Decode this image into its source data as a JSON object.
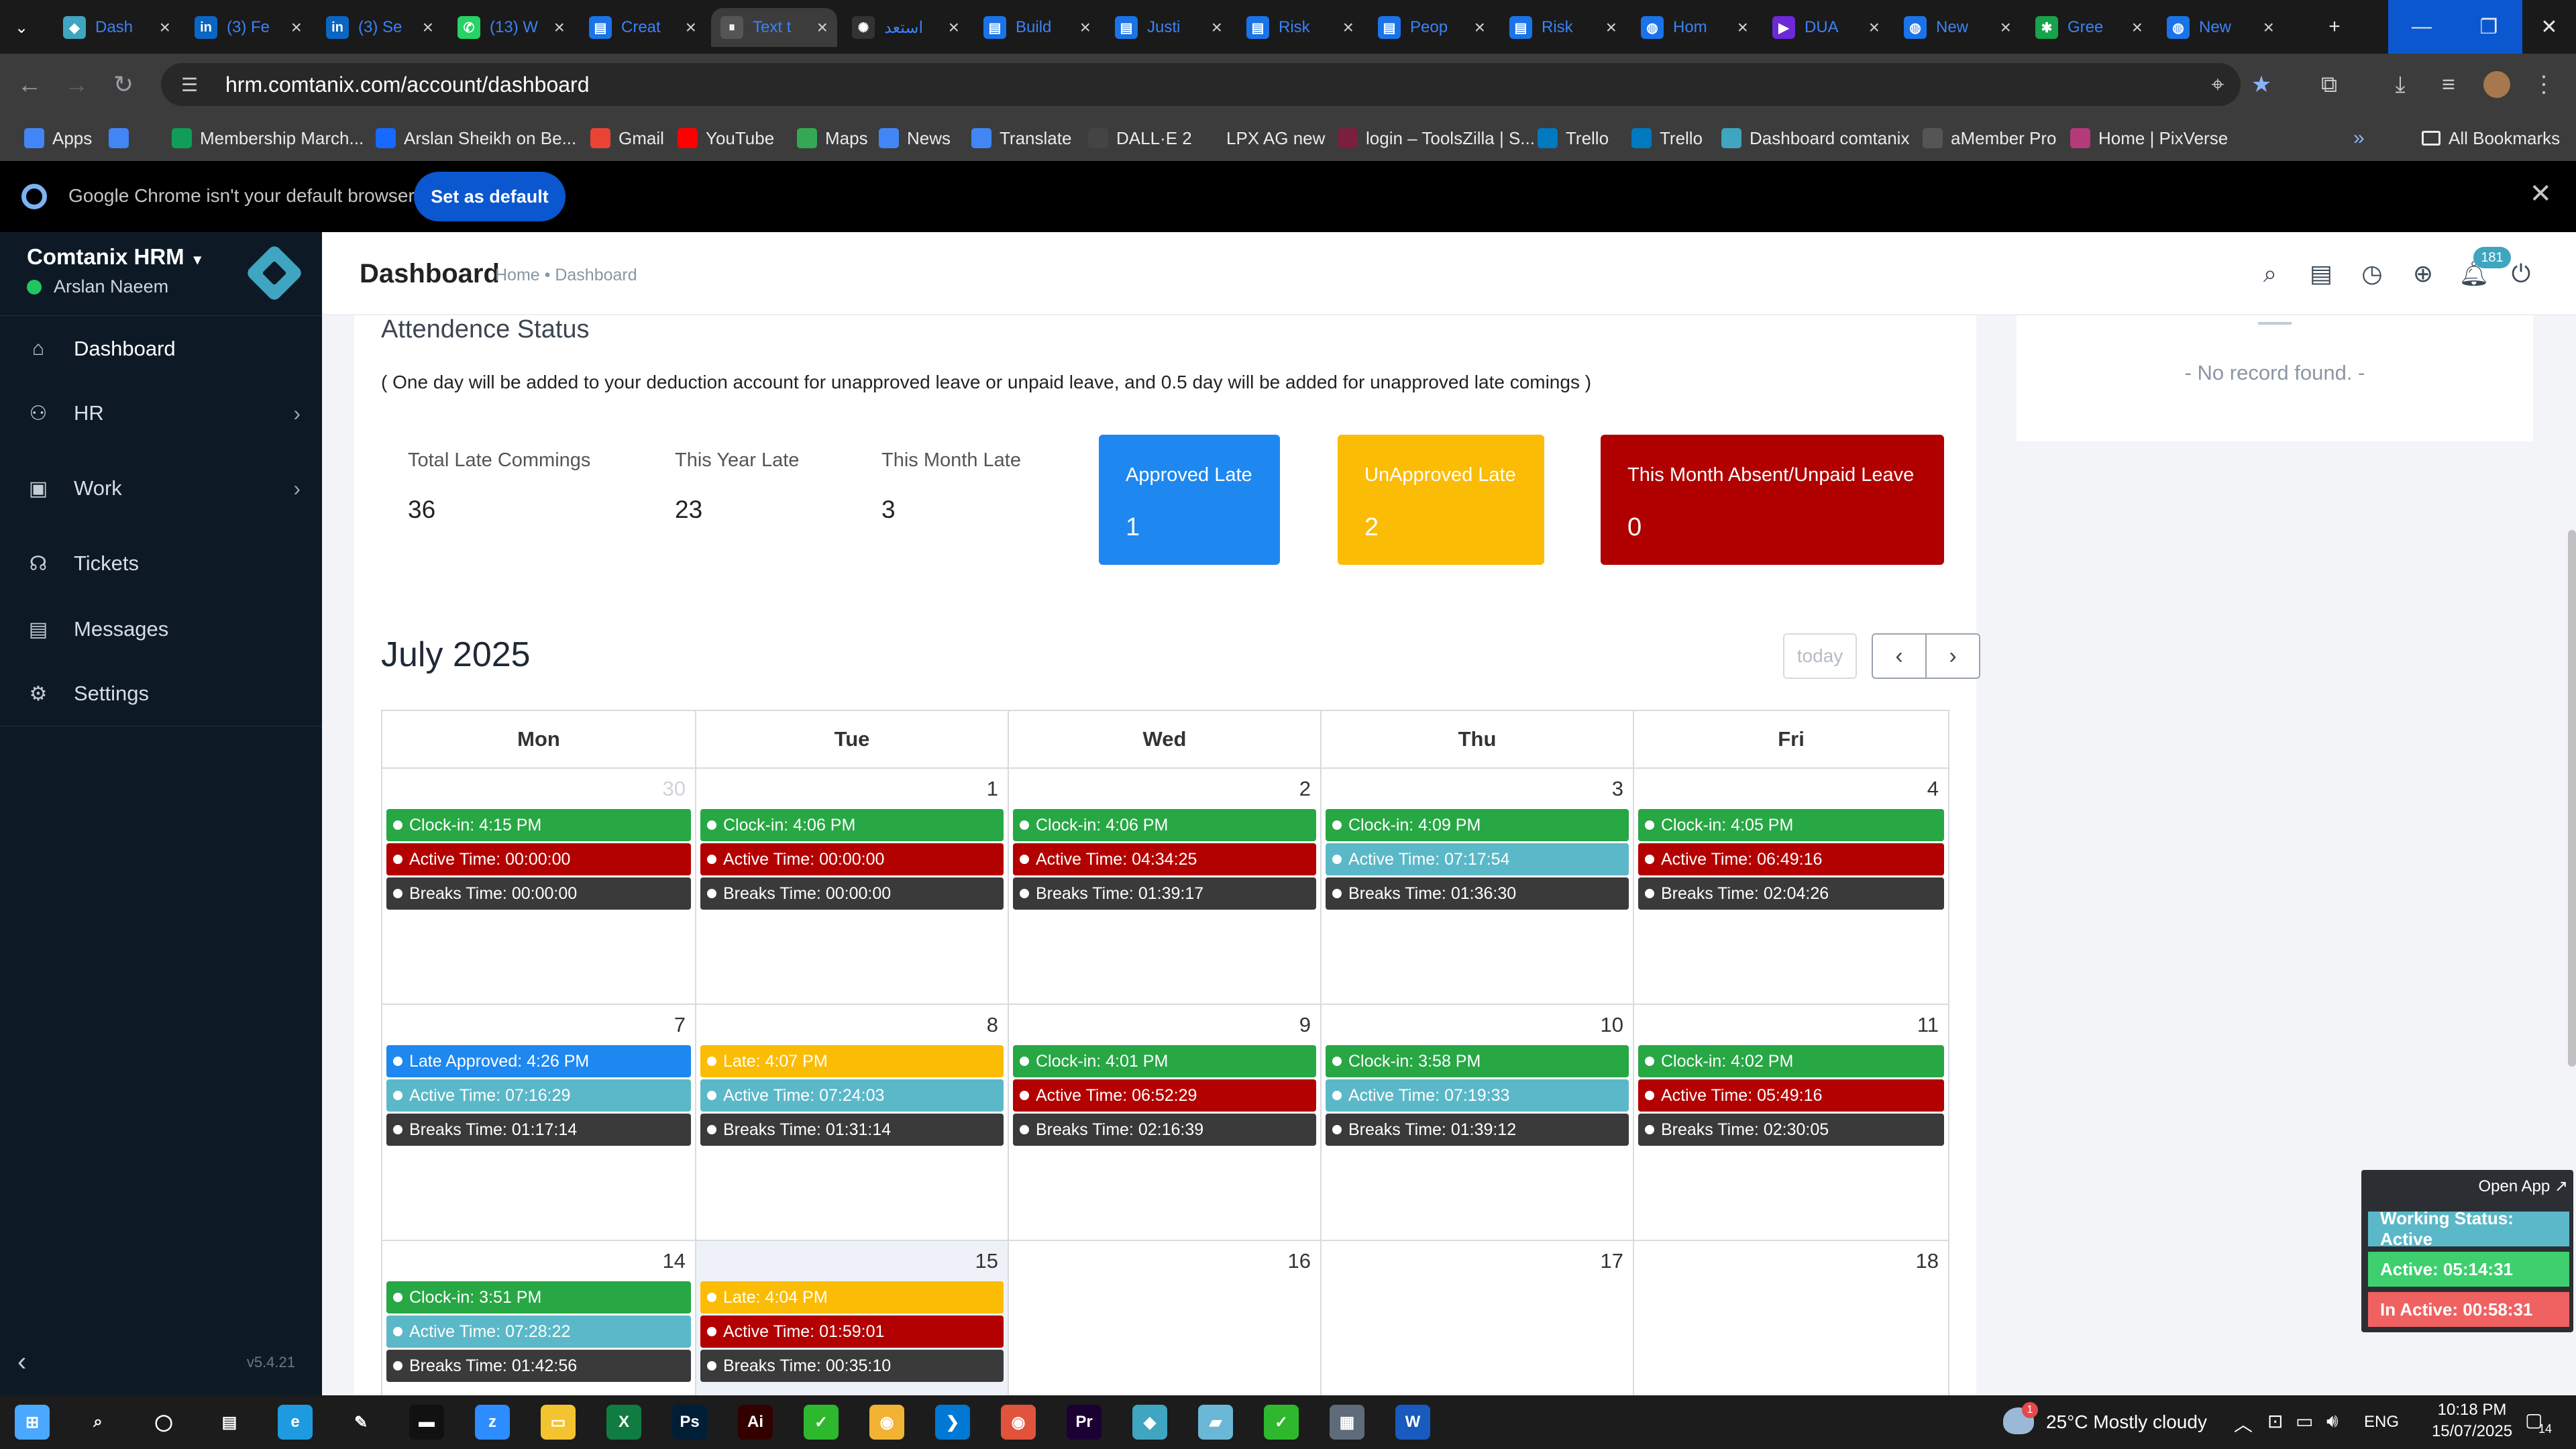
{
  "browser": {
    "tabs": [
      {
        "label": "Dash",
        "icon": "comtanix-icon",
        "color": "#3fa5c0"
      },
      {
        "label": "(3) Fe",
        "icon": "linkedin-icon",
        "color": "#0a66c2"
      },
      {
        "label": "(3) Se",
        "icon": "linkedin-icon",
        "color": "#0a66c2"
      },
      {
        "label": "(13) W",
        "icon": "whatsapp-icon",
        "color": "#25d366"
      },
      {
        "label": "Creat",
        "icon": "forms-icon",
        "color": "#1a73e8"
      },
      {
        "label": "Text t",
        "icon": "pause-icon",
        "color": "#555555"
      },
      {
        "label": "استعد",
        "icon": "openai-icon",
        "color": "#333333"
      },
      {
        "label": "Build",
        "icon": "forms-icon",
        "color": "#1a73e8"
      },
      {
        "label": "Justi",
        "icon": "forms-icon",
        "color": "#1a73e8"
      },
      {
        "label": "Risk",
        "icon": "forms-icon",
        "color": "#1a73e8"
      },
      {
        "label": "Peop",
        "icon": "forms-icon",
        "color": "#1a73e8"
      },
      {
        "label": "Risk",
        "icon": "forms-icon",
        "color": "#1a73e8"
      },
      {
        "label": "Hom",
        "icon": "globe-icon",
        "color": "#1a73e8"
      },
      {
        "label": "DUA",
        "icon": "video-icon",
        "color": "#6d28d9"
      },
      {
        "label": "New",
        "icon": "globe-icon",
        "color": "#1a73e8"
      },
      {
        "label": "Gree",
        "icon": "palm-icon",
        "color": "#16a34a"
      },
      {
        "label": "New",
        "icon": "globe-icon",
        "color": "#1a73e8"
      }
    ],
    "active_tab_index": 5,
    "url": "hrm.comtanix.com/account/dashboard",
    "bookmarks": [
      {
        "label": "Apps",
        "icon": "apps-grid-icon"
      },
      {
        "label": "",
        "icon": "grid-icon"
      },
      {
        "label": "Membership March...",
        "icon": "sheets-icon"
      },
      {
        "label": "Arslan Sheikh on Be...",
        "icon": "behance-icon"
      },
      {
        "label": "Gmail",
        "icon": "gmail-icon"
      },
      {
        "label": "YouTube",
        "icon": "youtube-icon"
      },
      {
        "label": "Maps",
        "icon": "maps-icon"
      },
      {
        "label": "News",
        "icon": "news-icon"
      },
      {
        "label": "Translate",
        "icon": "translate-icon"
      },
      {
        "label": "DALL·E 2",
        "icon": "openai-icon"
      },
      {
        "label": "LPX AG new",
        "icon": "dash-icon"
      },
      {
        "label": "login – ToolsZilla | S...",
        "icon": "toolszilla-icon"
      },
      {
        "label": "Trello",
        "icon": "trello-icon"
      },
      {
        "label": "Trello",
        "icon": "trello-icon"
      },
      {
        "label": "Dashboard comtanix",
        "icon": "comtanix-icon"
      },
      {
        "label": "aMember Pro",
        "icon": "amember-icon"
      },
      {
        "label": "Home | PixVerse",
        "icon": "pixverse-icon"
      }
    ],
    "all_bookmarks": "All Bookmarks",
    "infobar_message": "Google Chrome isn't your default browser",
    "set_default_label": "Set as default"
  },
  "sidebar": {
    "brand": "Comtanix HRM",
    "user": "Arslan Naeem",
    "items": [
      {
        "label": "Dashboard",
        "icon": "home-icon",
        "has_children": false
      },
      {
        "label": "HR",
        "icon": "users-icon",
        "has_children": true
      },
      {
        "label": "Work",
        "icon": "briefcase-icon",
        "has_children": true
      },
      {
        "label": "Tickets",
        "icon": "headset-icon",
        "has_children": false
      },
      {
        "label": "Messages",
        "icon": "message-icon",
        "has_children": false
      },
      {
        "label": "Settings",
        "icon": "gear-icon",
        "has_children": false
      }
    ],
    "version": "v5.4.21"
  },
  "header": {
    "title": "Dashboard",
    "breadcrumb": "Home • Dashboard",
    "notification_count": "181"
  },
  "right_panel": {
    "empty_text": "- No record found. -"
  },
  "attendance": {
    "title": "Attendence Status",
    "note": "( One day will be added to your deduction account for unapproved leave or unpaid leave, and 0.5 day will be added for unapproved late comings )",
    "stats": [
      {
        "label": "Total Late Commings",
        "value": "36"
      },
      {
        "label": "This Year Late",
        "value": "23"
      },
      {
        "label": "This Month Late",
        "value": "3"
      }
    ],
    "boxes": [
      {
        "label": "Approved Late",
        "value": "1",
        "color": "#1e88f0"
      },
      {
        "label": "UnApproved Late",
        "value": "2",
        "color": "#fbbc05"
      },
      {
        "label": "This Month Absent/Unpaid Leave",
        "value": "0",
        "color": "#b00000"
      }
    ]
  },
  "calendar": {
    "month_title": "July 2025",
    "today_label": "today",
    "weekdays": [
      "Mon",
      "Tue",
      "Wed",
      "Thu",
      "Fri"
    ],
    "event_colors": {
      "green": "#28a745",
      "red": "#b30000",
      "dark": "#3a3a3a",
      "teal": "#5bb8c8",
      "blue": "#1e88f0",
      "yellow": "#fbbc05"
    },
    "weeks": [
      [
        {
          "day": "30",
          "dim": true,
          "events": [
            {
              "text": "Clock-in: 4:15 PM",
              "color": "green"
            },
            {
              "text": "Active Time: 00:00:00",
              "color": "red"
            },
            {
              "text": "Breaks Time: 00:00:00",
              "color": "dark"
            }
          ]
        },
        {
          "day": "1",
          "events": [
            {
              "text": "Clock-in: 4:06 PM",
              "color": "green"
            },
            {
              "text": "Active Time: 00:00:00",
              "color": "red"
            },
            {
              "text": "Breaks Time: 00:00:00",
              "color": "dark"
            }
          ]
        },
        {
          "day": "2",
          "events": [
            {
              "text": "Clock-in: 4:06 PM",
              "color": "green"
            },
            {
              "text": "Active Time: 04:34:25",
              "color": "red"
            },
            {
              "text": "Breaks Time: 01:39:17",
              "color": "dark"
            }
          ]
        },
        {
          "day": "3",
          "events": [
            {
              "text": "Clock-in: 4:09 PM",
              "color": "green"
            },
            {
              "text": "Active Time: 07:17:54",
              "color": "teal"
            },
            {
              "text": "Breaks Time: 01:36:30",
              "color": "dark"
            }
          ]
        },
        {
          "day": "4",
          "events": [
            {
              "text": "Clock-in: 4:05 PM",
              "color": "green"
            },
            {
              "text": "Active Time: 06:49:16",
              "color": "red"
            },
            {
              "text": "Breaks Time: 02:04:26",
              "color": "dark"
            }
          ]
        }
      ],
      [
        {
          "day": "7",
          "events": [
            {
              "text": "Late Approved: 4:26 PM",
              "color": "blue"
            },
            {
              "text": "Active Time: 07:16:29",
              "color": "teal"
            },
            {
              "text": "Breaks Time: 01:17:14",
              "color": "dark"
            }
          ]
        },
        {
          "day": "8",
          "events": [
            {
              "text": "Late: 4:07 PM",
              "color": "yellow"
            },
            {
              "text": "Active Time: 07:24:03",
              "color": "teal"
            },
            {
              "text": "Breaks Time: 01:31:14",
              "color": "dark"
            }
          ]
        },
        {
          "day": "9",
          "events": [
            {
              "text": "Clock-in: 4:01 PM",
              "color": "green"
            },
            {
              "text": "Active Time: 06:52:29",
              "color": "red"
            },
            {
              "text": "Breaks Time: 02:16:39",
              "color": "dark"
            }
          ]
        },
        {
          "day": "10",
          "events": [
            {
              "text": "Clock-in: 3:58 PM",
              "color": "green"
            },
            {
              "text": "Active Time: 07:19:33",
              "color": "teal"
            },
            {
              "text": "Breaks Time: 01:39:12",
              "color": "dark"
            }
          ]
        },
        {
          "day": "11",
          "events": [
            {
              "text": "Clock-in: 4:02 PM",
              "color": "green"
            },
            {
              "text": "Active Time: 05:49:16",
              "color": "red"
            },
            {
              "text": "Breaks Time: 02:30:05",
              "color": "dark"
            }
          ]
        }
      ],
      [
        {
          "day": "14",
          "events": [
            {
              "text": "Clock-in: 3:51 PM",
              "color": "green"
            },
            {
              "text": "Active Time: 07:28:22",
              "color": "teal"
            },
            {
              "text": "Breaks Time: 01:42:56",
              "color": "dark"
            }
          ]
        },
        {
          "day": "15",
          "today": true,
          "events": [
            {
              "text": "Late: 4:04 PM",
              "color": "yellow"
            },
            {
              "text": "Active Time: 01:59:01",
              "color": "red"
            },
            {
              "text": "Breaks Time: 00:35:10",
              "color": "dark"
            }
          ]
        },
        {
          "day": "16",
          "events": []
        },
        {
          "day": "17",
          "events": []
        },
        {
          "day": "18",
          "events": []
        }
      ]
    ]
  },
  "widget": {
    "open_app": "Open App ↗",
    "working_status": "Working Status: Active",
    "active": "Active: 05:14:31",
    "inactive": "In Active: 00:58:31",
    "colors": {
      "status": "#5bb8c8",
      "active": "#3ecf6e",
      "inactive": "#f06262"
    }
  },
  "taskbar": {
    "apps": [
      {
        "name": "start-icon",
        "color": "#4aa8ff",
        "glyph": "⊞"
      },
      {
        "name": "search-icon",
        "color": "#1c1c1c",
        "glyph": "⌕"
      },
      {
        "name": "cortana-icon",
        "color": "#1c1c1c",
        "glyph": "◯"
      },
      {
        "name": "task-view-icon",
        "color": "#1c1c1c",
        "glyph": "▤"
      },
      {
        "name": "edge-icon",
        "color": "#1e9be0",
        "glyph": "e"
      },
      {
        "name": "pen-icon",
        "color": "#1c1c1c",
        "glyph": "✎"
      },
      {
        "name": "terminal-icon",
        "color": "#111111",
        "glyph": "▬"
      },
      {
        "name": "zoom-icon",
        "color": "#2d8cff",
        "glyph": "z"
      },
      {
        "name": "file-explorer-icon",
        "color": "#f4c430",
        "glyph": "▭"
      },
      {
        "name": "excel-icon",
        "color": "#107c41",
        "glyph": "X"
      },
      {
        "name": "photoshop-icon",
        "color": "#001e36",
        "glyph": "Ps"
      },
      {
        "name": "illustrator-icon",
        "color": "#330000",
        "glyph": "Ai"
      },
      {
        "name": "camtasia-icon",
        "color": "#2eb82e",
        "glyph": "✓"
      },
      {
        "name": "chrome-icon",
        "color": "#f2b233",
        "glyph": "◉"
      },
      {
        "name": "vscode-icon",
        "color": "#0078d4",
        "glyph": "❯"
      },
      {
        "name": "chrome-profile-icon",
        "color": "#e0533c",
        "glyph": "◉"
      },
      {
        "name": "premiere-icon",
        "color": "#1a0033",
        "glyph": "Pr"
      },
      {
        "name": "comtanix-app-icon",
        "color": "#3fa5c0",
        "glyph": "◆"
      },
      {
        "name": "notes-icon",
        "color": "#6bb7d6",
        "glyph": "▰"
      },
      {
        "name": "camtasia-2-icon",
        "color": "#2eb82e",
        "glyph": "✓"
      },
      {
        "name": "calculator-icon",
        "color": "#5f6b7a",
        "glyph": "▦"
      },
      {
        "name": "word-icon",
        "color": "#185abd",
        "glyph": "W"
      }
    ],
    "weather_badge": "1",
    "weather": "25°C  Mostly cloudy",
    "language": "ENG",
    "time": "10:18 PM",
    "date": "15/07/2025",
    "notification_count": "14"
  }
}
